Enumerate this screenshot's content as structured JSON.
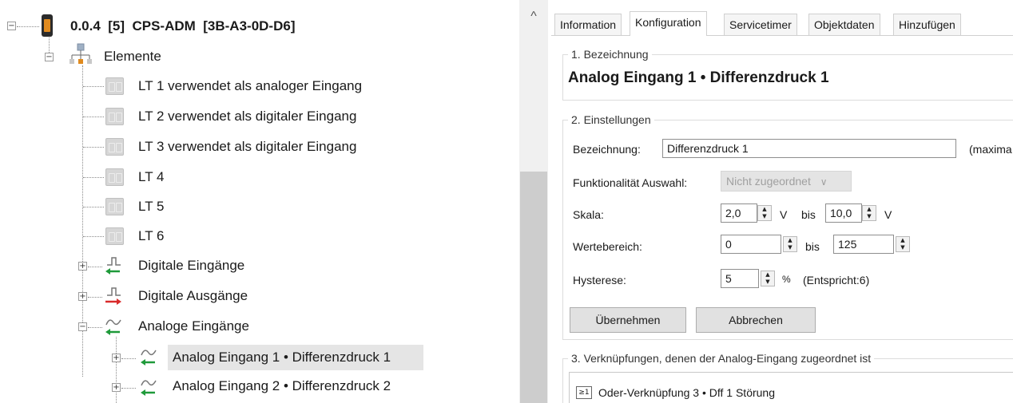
{
  "tree": {
    "root_label": "0.0.4  [5]  CPS-ADM  [3B-A3-0D-D6]",
    "elements_label": "Elemente",
    "lt_items": [
      "LT 1 verwendet als analoger Eingang",
      "LT 2 verwendet als digitaler Eingang",
      "LT 3 verwendet als digitaler Eingang",
      "LT 4",
      "LT 5",
      "LT 6"
    ],
    "digital_inputs_label": "Digitale Eingänge",
    "digital_outputs_label": "Digitale Ausgänge",
    "analog_inputs_label": "Analoge Eingänge",
    "analog_children": [
      "Analog Eingang 1 • Differenzdruck 1",
      "Analog Eingang 2 • Differenzdruck 2"
    ],
    "expander_collapsed": "+",
    "expander_expanded": "−"
  },
  "scrollbar": {
    "up_arrow": "^"
  },
  "tabs": [
    "Information",
    "Konfiguration",
    "Servicetimer",
    "Objektdaten",
    "Hinzufügen"
  ],
  "active_tab": "Konfiguration",
  "section1": {
    "title": "1. Bezeichnung",
    "heading": "Analog Eingang 1 • Differenzdruck 1"
  },
  "section2": {
    "title": "2. Einstellungen",
    "bezeichnung_label": "Bezeichnung:",
    "bezeichnung_value": "Differenzdruck 1",
    "bezeichnung_hint": "(maxima",
    "funktion_label": "Funktionalität Auswahl:",
    "funktion_value": "Nicht zugeordnet",
    "funktion_arrow": "∨",
    "skala_label": "Skala:",
    "skala_from": "2,0",
    "skala_unit_from": "V",
    "skala_bis": "bis",
    "skala_to": "10,0",
    "skala_unit_to": "V",
    "werte_label": "Wertebereich:",
    "werte_from": "0",
    "werte_bis": "bis",
    "werte_to": "125",
    "hysterese_label": "Hysterese:",
    "hysterese_value": "5",
    "hysterese_unit": "%",
    "hysterese_note": "(Entspricht:6)",
    "apply_label": "Übernehmen",
    "cancel_label": "Abbrechen"
  },
  "section3": {
    "title": "3. Verknüpfungen, denen der Analog-Eingang zugeordnet ist",
    "items": [
      "Oder-Verknüpfung 3 • Dff 1 Störung"
    ],
    "item_icon_text": "≥1"
  },
  "colors": {
    "arrow_green": "#1f9a3a",
    "arrow_red": "#d92b2b",
    "selection": "#e5e5e5"
  }
}
